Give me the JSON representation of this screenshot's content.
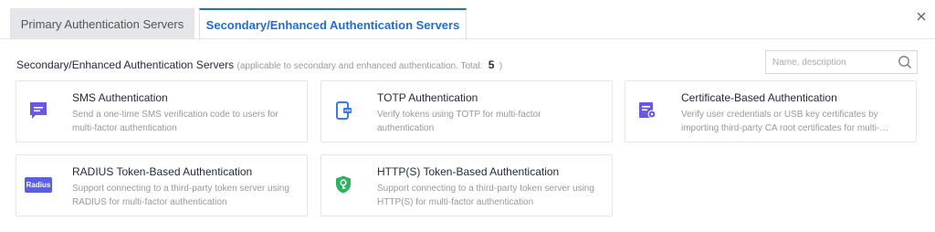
{
  "tabs": [
    {
      "label": "Primary Authentication Servers",
      "active": false
    },
    {
      "label": "Secondary/Enhanced Authentication Servers",
      "active": true
    }
  ],
  "heading": {
    "title": "Secondary/Enhanced Authentication Servers",
    "note": "(applicable to secondary and enhanced authentication. Total:",
    "total": "5",
    "note_end": ")"
  },
  "search": {
    "placeholder": "Name, description",
    "value": "",
    "icon": "search-icon"
  },
  "close_icon": "close-icon",
  "colors": {
    "accent": "#1f6ed4",
    "purple": "#6b57e0",
    "blue": "#3a7bf0",
    "green": "#2db35f"
  },
  "cards": [
    {
      "title": "SMS Authentication",
      "desc": "Send a one-time SMS verification code to users for multi-factor authentication",
      "icon": "sms-icon"
    },
    {
      "title": "TOTP Authentication",
      "desc": "Verify tokens using TOTP for multi-factor authentication",
      "icon": "totp-icon"
    },
    {
      "title": "Certificate-Based Authentication",
      "desc": "Verify user credentials or USB key certificates by importing third-party CA root certificates for multi-factor authentication",
      "icon": "certificate-icon"
    },
    {
      "title": "RADIUS Token-Based Authentication",
      "desc": "Support connecting to a third-party token server using RADIUS for multi-factor authentication",
      "icon": "radius-icon",
      "badge": "Radius"
    },
    {
      "title": "HTTP(S) Token-Based Authentication",
      "desc": "Support connecting to a third-party token server using HTTP(S) for multi-factor authentication",
      "icon": "shield-key-icon"
    }
  ]
}
